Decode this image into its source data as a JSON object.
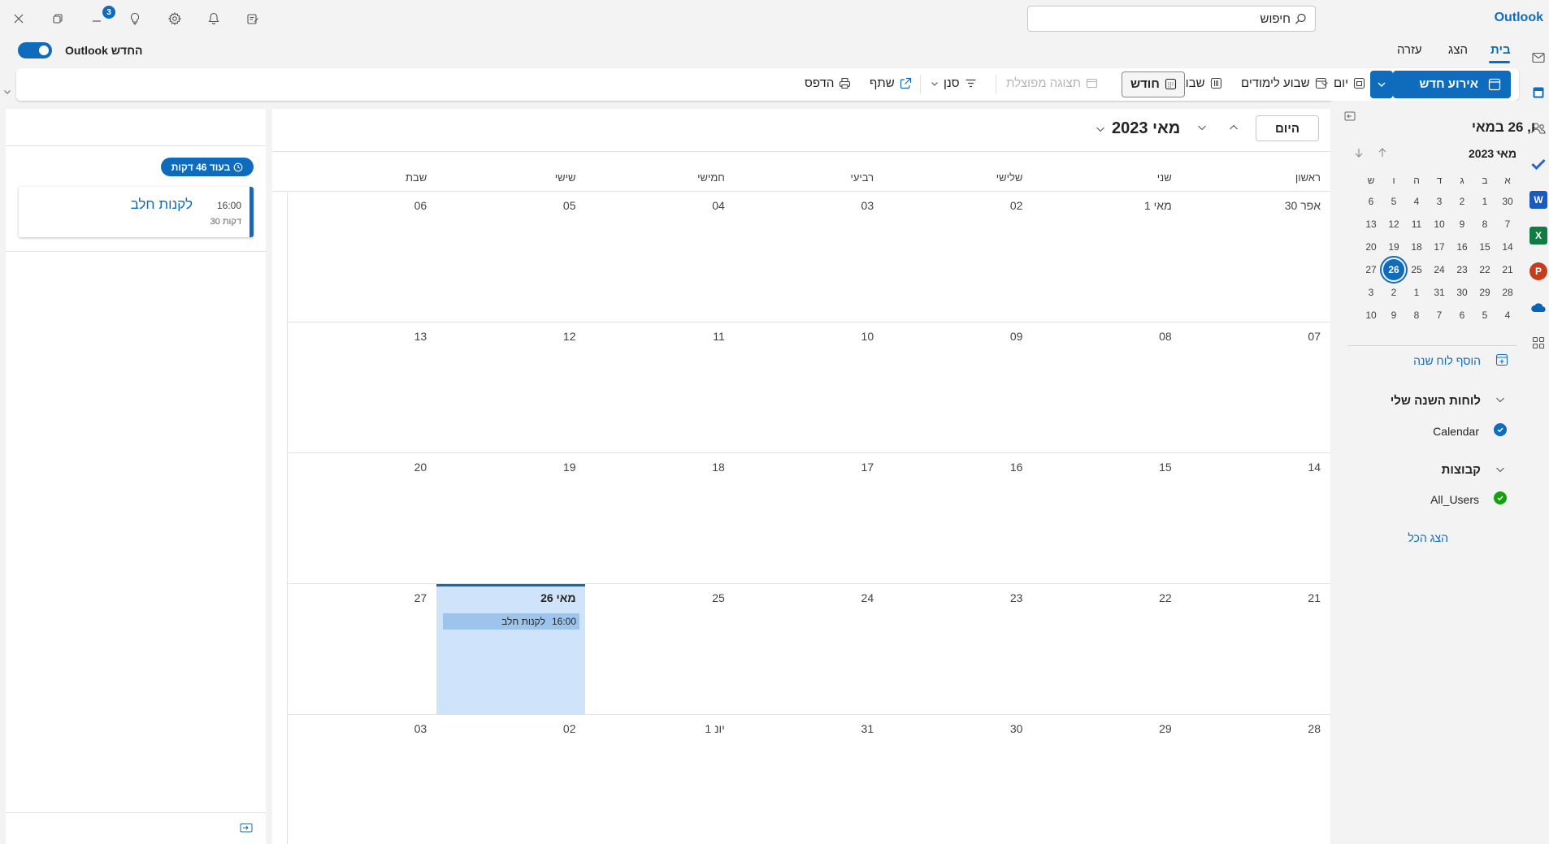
{
  "app": {
    "brand": "Outlook",
    "notifications_count": "3"
  },
  "search": {
    "text": "חיפוש"
  },
  "ribbon": {
    "tabs": [
      "בית",
      "הצג",
      "עזרה"
    ],
    "toggle_label": "Outlook החדש"
  },
  "toolbar": {
    "new_event": "אירוע חדש",
    "day": "יום",
    "work_week": "שבוע לימודים",
    "week": "שבוע",
    "month": "חודש",
    "split_view": "תצוגה מפוצלת",
    "filter": "סנן",
    "share": "שתף",
    "print": "הדפס"
  },
  "mini_calendar": {
    "title": "מאי 2023",
    "weekdays": [
      "א",
      "ב",
      "ג",
      "ד",
      "ה",
      "ו",
      "ש"
    ],
    "weeks": [
      [
        "30",
        "1",
        "2",
        "3",
        "4",
        "5",
        "6"
      ],
      [
        "7",
        "8",
        "9",
        "10",
        "11",
        "12",
        "13"
      ],
      [
        "14",
        "15",
        "16",
        "17",
        "18",
        "19",
        "20"
      ],
      [
        "21",
        "22",
        "23",
        "24",
        "25",
        "26",
        "27"
      ],
      [
        "28",
        "29",
        "30",
        "31",
        "1",
        "2",
        "3"
      ],
      [
        "4",
        "5",
        "6",
        "7",
        "8",
        "9",
        "10"
      ]
    ],
    "selected": "26"
  },
  "nav": {
    "add_calendar": "הוסף לוח שנה",
    "my_calendars": "לוחות השנה שלי",
    "calendar_name": "Calendar",
    "groups": "קבוצות",
    "group_name": "All_Users",
    "show_all": "הצג הכל",
    "colors": {
      "calendar": "#0f6cbd",
      "group": "#13a10e"
    }
  },
  "main": {
    "today_button": "היום",
    "month_title": "מאי 2023",
    "day_names": [
      "ראשון",
      "שני",
      "שלישי",
      "רביעי",
      "חמישי",
      "שישי",
      "שבת"
    ],
    "weeks": [
      [
        "30 אפר",
        "1 מאי",
        "02",
        "03",
        "04",
        "05",
        "06"
      ],
      [
        "07",
        "08",
        "09",
        "10",
        "11",
        "12",
        "13"
      ],
      [
        "14",
        "15",
        "16",
        "17",
        "18",
        "19",
        "20"
      ],
      [
        "21",
        "22",
        "23",
        "24",
        "25",
        "26 מאי",
        "27"
      ],
      [
        "28",
        "29",
        "30",
        "31",
        "1 יונ",
        "02",
        "03"
      ]
    ],
    "event": {
      "time": "16:00",
      "title": "לקנות חלב"
    }
  },
  "agenda": {
    "title": "ו, 26 במאי",
    "in_badge": "בעוד 46 דקות",
    "event_title": "לקנות חלב",
    "event_time": "16:00",
    "event_duration": "30 דקות"
  }
}
